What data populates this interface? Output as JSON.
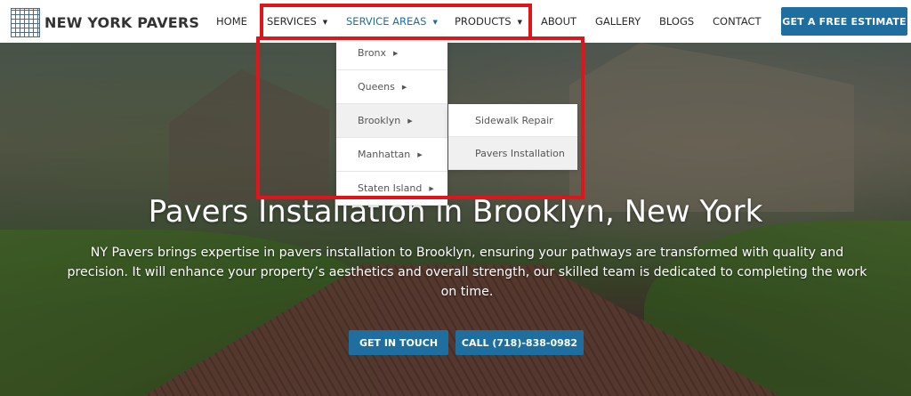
{
  "brand": {
    "name": "NEW YORK PAVERS",
    "logo_icon": "maze-logo-icon"
  },
  "nav": {
    "items": [
      {
        "label": "HOME",
        "has_caret": false
      },
      {
        "label": "SERVICES",
        "has_caret": true
      },
      {
        "label": "SERVICE AREAS",
        "has_caret": true,
        "active": true
      },
      {
        "label": "PRODUCTS",
        "has_caret": true
      },
      {
        "label": "ABOUT",
        "has_caret": false
      },
      {
        "label": "GALLERY",
        "has_caret": false
      },
      {
        "label": "BLOGS",
        "has_caret": false
      },
      {
        "label": "CONTACT",
        "has_caret": false
      }
    ],
    "cta": "GET A FREE ESTIMATE"
  },
  "service_areas_menu": {
    "items": [
      "Bronx",
      "Queens",
      "Brooklyn",
      "Manhattan",
      "Staten Island"
    ],
    "hovered": "Brooklyn"
  },
  "brooklyn_submenu": {
    "items": [
      "Sidewalk Repair",
      "Pavers Installation"
    ],
    "hovered": "Pavers Installation"
  },
  "hero": {
    "title": "Pavers Installation in Brooklyn, New York",
    "body": "NY Pavers brings expertise in pavers installation to Brooklyn, ensuring your pathways are transformed with quality and precision. It will enhance your property’s aesthetics and overall strength, our skilled team is dedicated to completing the work on time.",
    "buttons": {
      "primary": "GET IN TOUCH",
      "secondary": "CALL (718)-838-0982"
    }
  },
  "colors": {
    "accent": "#1e6f9f",
    "highlight": "#e0141b"
  }
}
